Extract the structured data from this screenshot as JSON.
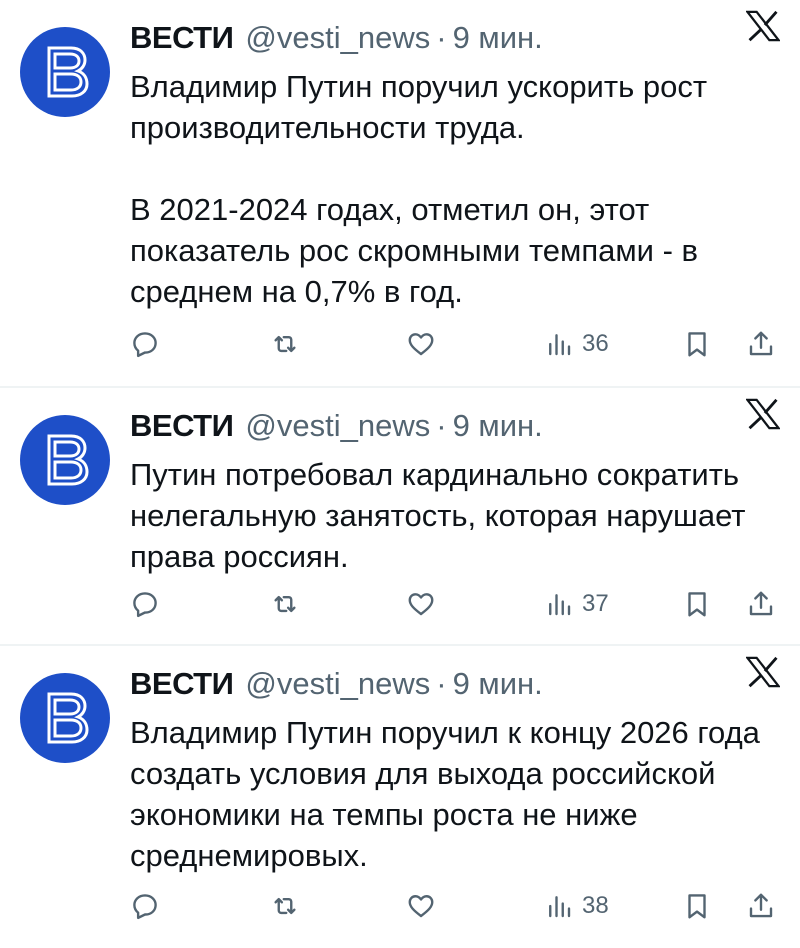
{
  "colors": {
    "avatar_bg": "#1e4fc8",
    "text": "#0f1419",
    "secondary": "#536471",
    "divider": "#eff3f4"
  },
  "tweets": [
    {
      "name": "ВЕСТИ",
      "handle": "@vesti_news",
      "separator": "·",
      "time": "9 мин.",
      "text": "Владимир Путин поручил ускорить рост производительности труда.\n\nВ 2021-2024 годах, отметил он, этот показатель рос скромными темпами - в среднем на 0,7% в год.",
      "views": "36"
    },
    {
      "name": "ВЕСТИ",
      "handle": "@vesti_news",
      "separator": "·",
      "time": "9 мин.",
      "text": "Путин потребовал кардинально сократить нелегальную занятость, которая нарушает права россиян.",
      "views": "37"
    },
    {
      "name": "ВЕСТИ",
      "handle": "@vesti_news",
      "separator": "·",
      "time": "9 мин.",
      "text": "Владимир Путин поручил к концу 2026 года создать условия для выхода российской экономики на темпы роста не ниже среднемировых.",
      "views": "38"
    }
  ],
  "icons": {
    "avatar": "vesti-logo-icon",
    "platform": "x-logo-icon",
    "reply": "reply-icon",
    "retweet": "retweet-icon",
    "like": "heart-icon",
    "views": "views-icon",
    "bookmark": "bookmark-icon",
    "share": "share-icon"
  }
}
